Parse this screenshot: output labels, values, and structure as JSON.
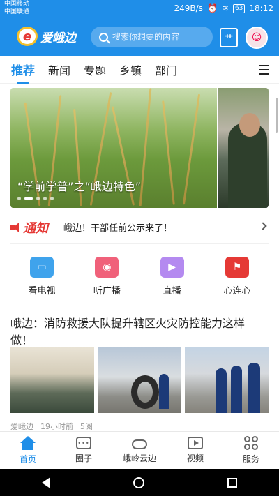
{
  "status_bar": {
    "carrier_1": "中国移动",
    "carrier_2": "中国联通",
    "network_speed": "249B/s",
    "battery": "63",
    "time": "18:12"
  },
  "header": {
    "app_name": "爱峨边",
    "logo_mark": "e",
    "search_placeholder": "搜索你想要的内容",
    "news_icon_label": "艹"
  },
  "tabs": [
    {
      "label": "推荐",
      "active": true
    },
    {
      "label": "新闻",
      "active": false
    },
    {
      "label": "专题",
      "active": false
    },
    {
      "label": "乡镇",
      "active": false
    },
    {
      "label": "部门",
      "active": false
    }
  ],
  "carousel": {
    "caption": "“学前学普”之“峨边特色”",
    "slide_count": 5,
    "active_index": 1
  },
  "notice": {
    "tag": "通知",
    "text": "峨边！干部任前公示来了！"
  },
  "features": [
    {
      "label": "看电视",
      "icon": "tv-icon",
      "color": "#3fa3ec"
    },
    {
      "label": "听广播",
      "icon": "radio-icon",
      "color": "#f0617a"
    },
    {
      "label": "直播",
      "icon": "live-icon",
      "color": "#b48af0"
    },
    {
      "label": "心连心",
      "icon": "party-flag-icon",
      "color": "#e53935"
    }
  ],
  "article": {
    "title": "峨边：消防救援大队提升辖区火灾防控能力这样做！",
    "source": "爱峨边",
    "time": "19小时前",
    "views": "5阅"
  },
  "bottom_nav": [
    {
      "label": "首页",
      "icon": "home-icon",
      "active": true
    },
    {
      "label": "圈子",
      "icon": "chat-bubble-icon",
      "active": false
    },
    {
      "label": "峨岭云边",
      "icon": "cloud-icon",
      "active": false
    },
    {
      "label": "视频",
      "icon": "video-icon",
      "active": false
    },
    {
      "label": "服务",
      "icon": "grid-icon",
      "active": false
    }
  ],
  "colors": {
    "brand": "#1f8ee8",
    "notice_red": "#e53935"
  }
}
